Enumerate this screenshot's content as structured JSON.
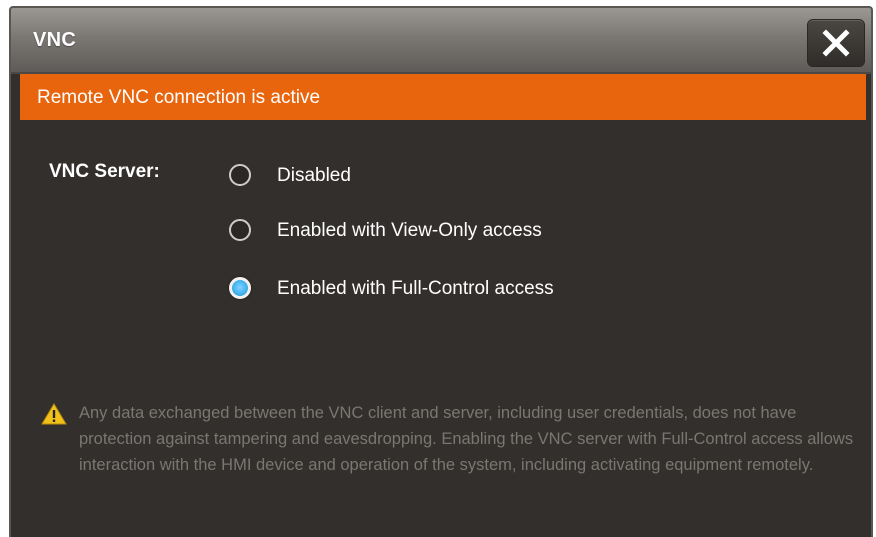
{
  "dialog": {
    "title": "VNC",
    "close_icon": "close-icon"
  },
  "banner": {
    "text": "Remote VNC connection is active",
    "color": "#e8650e"
  },
  "server": {
    "label": "VNC Server:",
    "options": [
      {
        "label": "Disabled",
        "selected": false
      },
      {
        "label": "Enabled with View-Only access",
        "selected": false
      },
      {
        "label": "Enabled with Full-Control access",
        "selected": true
      }
    ]
  },
  "warning": {
    "icon": "warning-icon",
    "text": "Any data exchanged between the VNC client and server, including user credentials, does not have protection against tampering and eavesdropping. Enabling the VNC server with Full-Control access allows interaction with the HMI device and operation of the system, including activating equipment remotely."
  },
  "colors": {
    "background": "#332f2c",
    "accent_selected": "#45b3f0",
    "warning_text": "#7a7672"
  }
}
